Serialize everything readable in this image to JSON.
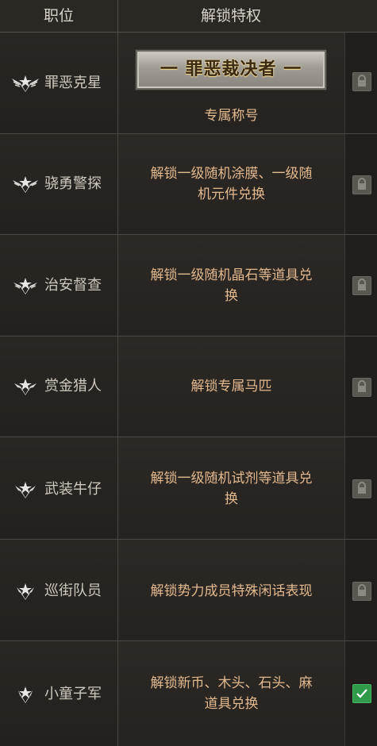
{
  "header": {
    "col_rank": "职位",
    "col_privilege": "解锁特权"
  },
  "ranks": [
    {
      "name": "罪恶克星",
      "badge": "wings-star-rank-7-icon",
      "title_plate": "一 罪恶裁决者 一",
      "privilege": "专属称号",
      "status": "locked"
    },
    {
      "name": "骁勇警探",
      "badge": "wings-star-rank-6-icon",
      "privilege_lines": [
        "解锁一级随机涂膜、一级随",
        "机元件兑换"
      ],
      "status": "locked"
    },
    {
      "name": "治安督查",
      "badge": "wings-star-rank-5-icon",
      "privilege_lines": [
        "解锁一级随机晶石等道具兑",
        "换"
      ],
      "status": "locked"
    },
    {
      "name": "赏金猎人",
      "badge": "wings-star-rank-4-icon",
      "privilege_lines": [
        "解锁专属马匹"
      ],
      "status": "locked"
    },
    {
      "name": "武装牛仔",
      "badge": "wings-star-rank-3-icon",
      "privilege_lines": [
        "解锁一级随机试剂等道具兑",
        "换"
      ],
      "status": "locked"
    },
    {
      "name": "巡街队员",
      "badge": "wings-star-rank-2-icon",
      "privilege_lines": [
        "解锁势力成员特殊闲话表现"
      ],
      "status": "locked"
    },
    {
      "name": "小童子军",
      "badge": "wings-star-rank-1-icon",
      "privilege_lines": [
        "解锁新币、木头、石头、麻",
        "道具兑换"
      ],
      "status": "unlocked"
    }
  ],
  "colors": {
    "privilege_text": "#e2b98f",
    "rank_text": "#cfc8bd",
    "check": "#2f9a4a",
    "lock": "#5a5650"
  }
}
